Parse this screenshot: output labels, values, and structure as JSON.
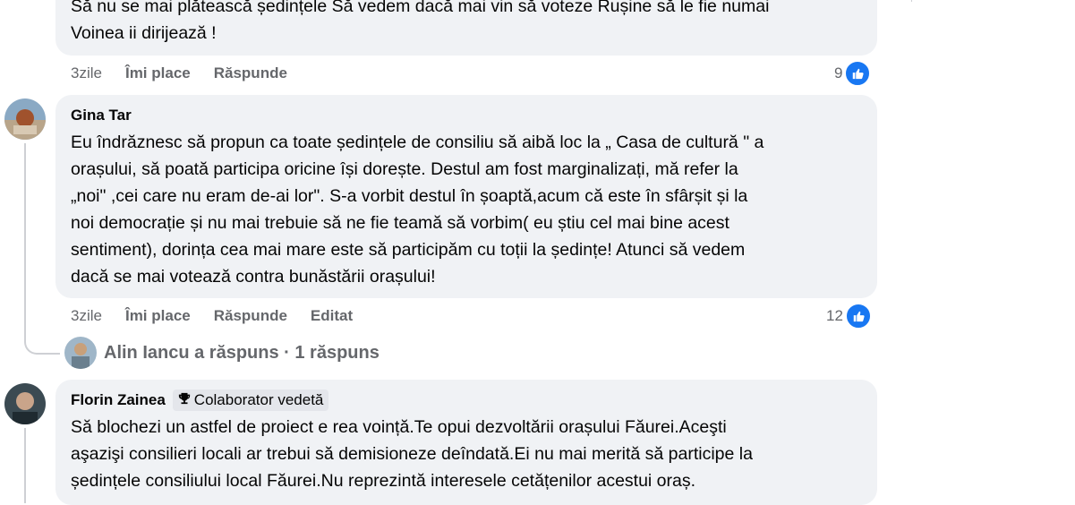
{
  "comments": [
    {
      "text": "Să nu se mai plătească ședințele Să vedem dacă mai vin să voteze Rușine să le fie numai\nVoinea ii dirijează !",
      "time": "3zile",
      "like": "Îmi place",
      "reply": "Răspunde",
      "reaction_count": "9"
    },
    {
      "author": "Gina Tar",
      "text": "Eu îndrăznesc să propun ca toate ședințele de consiliu să aibă loc la „ Casa de cultură \" a\norașului, să poată participa oricine își dorește. Destul am fost marginalizați, mă refer la\n„noi\" ,cei care nu eram de-ai lor\". S-a vorbit destul în șoaptă,acum că este în sfârșit și la\nnoi democrație și nu mai trebuie să ne fie teamă să vorbim( eu știu cel mai bine acest\nsentiment), dorința cea mai mare este să participăm cu toții la ședințe! Atunci să vedem\ndacă se mai votează contra bunăstării orașului!",
      "time": "3zile",
      "like": "Îmi place",
      "reply": "Răspunde",
      "edited": "Editat",
      "reaction_count": "12",
      "replies": "Alin Iancu a răspuns · 1 răspuns"
    },
    {
      "author": "Florin Zainea",
      "badge": "Colaborator vedetă",
      "text": "Să blochezi un astfel de proiect e rea voință.Te opui dezvoltării orașului Făurei.Aceşti\naşazişi consilieri locali ar trebui să demisioneze deîndată.Ei nu mai merită să participe la\nședințele consiliului local Făurei.Nu reprezintă interesele cetățenilor acestui oraș."
    }
  ],
  "icons": {
    "reaction": "like-thumb-icon",
    "badge": "trophy-icon"
  },
  "colors": {
    "bubble": "#f0f2f5",
    "meta": "#65676b",
    "like_blue": "#1877f2"
  }
}
